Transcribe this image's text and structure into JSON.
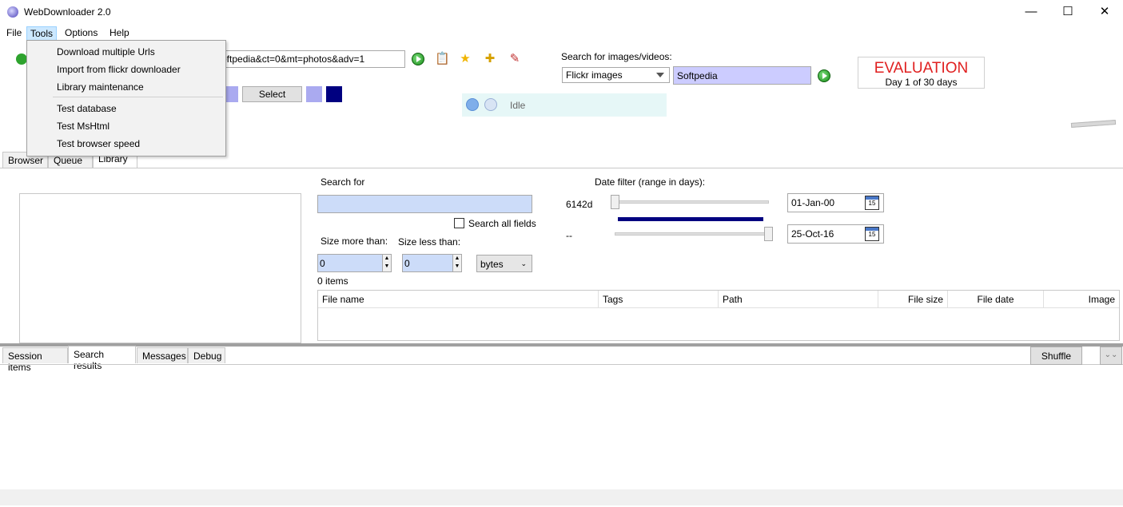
{
  "window": {
    "title": "WebDownloader 2.0",
    "minimize": "—",
    "maximize": "☐",
    "close": "✕"
  },
  "menu": {
    "file": "File",
    "tools": "Tools",
    "options": "Options",
    "help": "Help"
  },
  "tools_menu": {
    "items": [
      "Download multiple Urls",
      "Import from flickr downloader",
      "Library maintenance",
      "Test database",
      "Test MsHtml",
      "Test browser speed"
    ]
  },
  "toolbar": {
    "url_value": "oftpedia&ct=0&mt=photos&adv=1",
    "select_label": "Select",
    "icons": [
      "go-icon",
      "paste-icon",
      "star-icon",
      "add-favorite-icon",
      "settings-icon"
    ]
  },
  "search": {
    "label": "Search for images/videos:",
    "source": "Flickr images",
    "keyword": "Softpedia"
  },
  "evaluation": {
    "title": "EVALUATION",
    "subtitle": "Day 1 of 30 days"
  },
  "status": {
    "text": "Idle"
  },
  "main_tabs": [
    "Browser",
    "Queue",
    "Library"
  ],
  "library": {
    "search_for_label": "Search for",
    "search_value": "",
    "search_all_fields": "Search all fields",
    "size_more_label": "Size more than:",
    "size_less_label": "Size less than:",
    "size_more_value": "0",
    "size_less_value": "0",
    "size_unit": "bytes",
    "items_count": "0 items",
    "date_filter_label": "Date filter (range in days):",
    "range_from": "6142d",
    "range_to": "--",
    "date_from": "01-Jan-00",
    "date_to": "25-Oct-16",
    "calendar_day": "15",
    "columns": [
      "File name",
      "Tags",
      "Path",
      "File size",
      "File date",
      "Image"
    ]
  },
  "bottom_tabs": [
    "Session items",
    "Search results",
    "Messages",
    "Debug"
  ],
  "bottom": {
    "shuffle": "Shuffle",
    "collapse": "⌄⌄"
  },
  "colors": {
    "accent_swatch_light": "#aaaaf0",
    "accent_swatch_dark": "#000080",
    "eval_red": "#e02020"
  }
}
